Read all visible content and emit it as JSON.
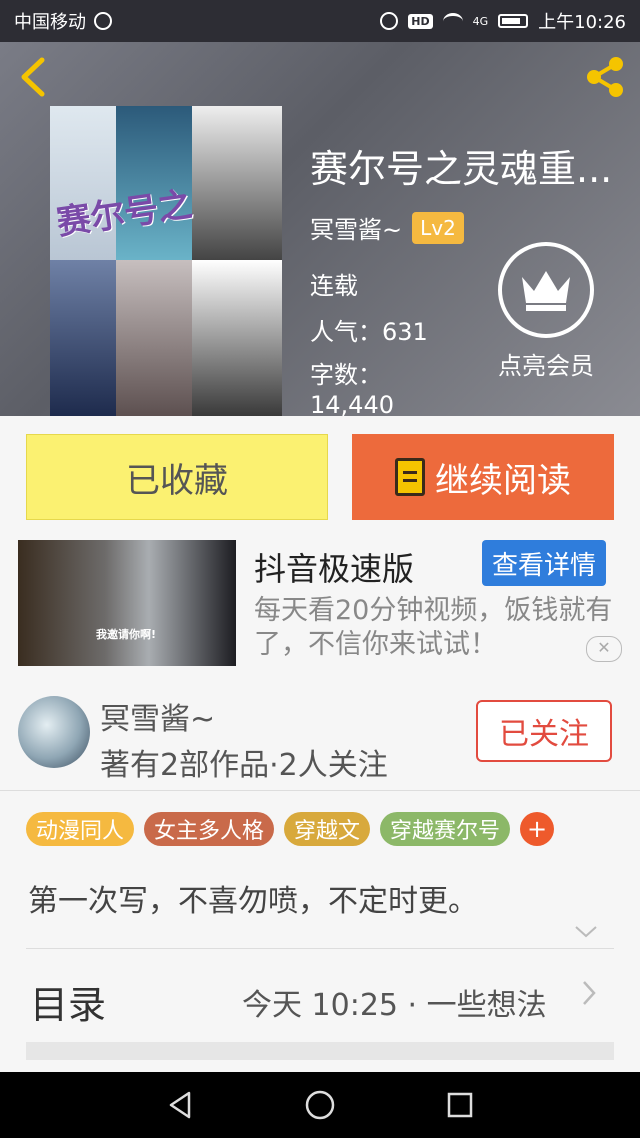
{
  "status_bar": {
    "carrier": "中国移动",
    "network": "4G",
    "hd": "HD",
    "time": "上午10:26"
  },
  "header": {
    "back_icon": "chevron-left-icon",
    "share_icon": "share-icon",
    "cover_text": "赛尔号之",
    "title": "赛尔号之灵魂重...",
    "author": "冥雪酱~",
    "level": "Lv2",
    "status": "连载",
    "popularity_label": "人气：",
    "popularity": "631",
    "words_label": "字数：",
    "words": "14,440",
    "vip_label": "点亮会员",
    "vip_icon": "crown-icon",
    "accent_color": "#f5c400"
  },
  "actions": {
    "collected_label": "已收藏",
    "read_label": "继续阅读",
    "read_icon": "book-icon",
    "collected_color": "#fbf171",
    "read_color": "#ed6a3c"
  },
  "ad": {
    "title": "抖音极速版",
    "button": "查看详情",
    "description": "每天看20分钟视频，饭钱就有了，不信你来试试！",
    "thumb_caption": "我邀请你啊!",
    "close_icon": "close-icon"
  },
  "author_block": {
    "name": "冥雪酱~",
    "stats": "著有2部作品·2人关注",
    "follow_label": "已关注"
  },
  "tags": [
    {
      "label": "动漫同人",
      "color": "#f5b940"
    },
    {
      "label": "女主多人格",
      "color": "#c96a4a"
    },
    {
      "label": "穿越文",
      "color": "#d8a93c"
    },
    {
      "label": "穿越赛尔号",
      "color": "#8cb868"
    }
  ],
  "tag_add": "+",
  "description": "第一次写，不喜勿喷，不定时更。",
  "toc": {
    "label": "目录",
    "latest": "今天 10:25 · 一些想法"
  },
  "nav": [
    "back-icon",
    "home-icon",
    "recents-icon"
  ]
}
